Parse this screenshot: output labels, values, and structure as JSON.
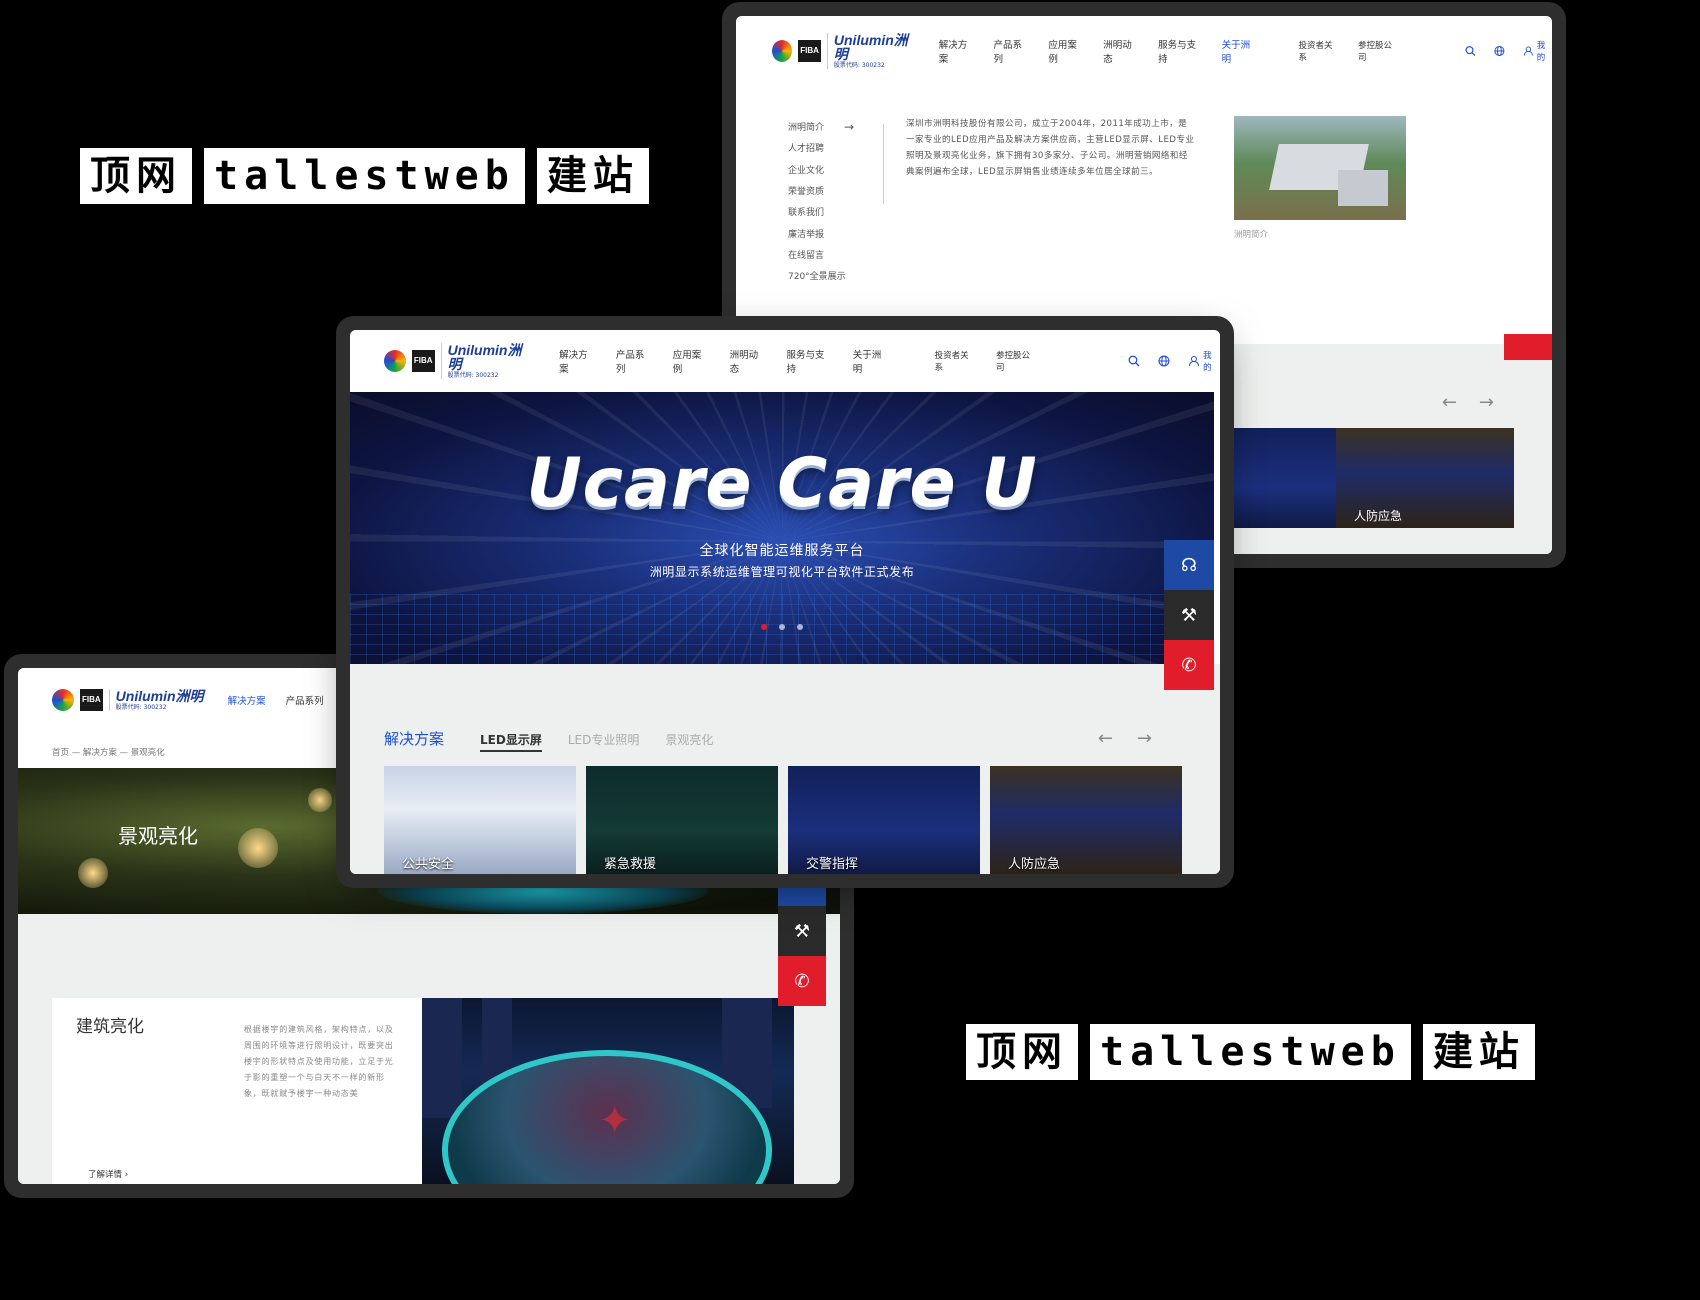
{
  "watermark": {
    "word1": "顶网",
    "word2": "tallestweb",
    "word3": "建站"
  },
  "brand": {
    "logo_text": "Unilumin洲明",
    "stock_code": "股票代码: 300232",
    "fiba": "FIBA"
  },
  "nav": {
    "items": [
      "解决方案",
      "产品系列",
      "应用案例",
      "洲明动态",
      "服务与支持",
      "关于洲明"
    ],
    "secondary": [
      "投资者关系",
      "参控股公司"
    ],
    "login": "我的"
  },
  "window_about": {
    "sidebar": [
      "洲明简介",
      "人才招聘",
      "企业文化",
      "荣誉资质",
      "联系我们",
      "廉洁举报",
      "在线留言",
      "720°全景展示"
    ],
    "intro": "深圳市洲明科技股份有限公司，成立于2004年，2011年成功上市，是一家专业的LED应用产品及解决方案供应商，主营LED显示屏、LED专业照明及景观亮化业务，旗下拥有30多家分、子公司。洲明营销网络和经典案例遍布全球，LED显示屏销售业绩连续多年位居全球前三。",
    "photo_caption": "洲明简介",
    "thumb_label": "人防应急"
  },
  "window_home": {
    "banner_title": "Ucare Care U",
    "banner_sub1": "全球化智能运维服务平台",
    "banner_sub2": "洲明显示系统运维管理可视化平台软件正式发布",
    "section_title": "解决方案",
    "tabs": [
      "LED显示屏",
      "LED专业照明",
      "景观亮化"
    ],
    "cards": [
      "公共安全",
      "紧急救援",
      "交警指挥",
      "人防应急"
    ]
  },
  "window_landscape": {
    "breadcrumb": "首页 — 解决方案 — 景观亮化",
    "hero_title": "景观亮化",
    "panel_title": "建筑亮化",
    "panel_text": "根据楼宇的建筑风格，架构特点，以及周围的环境等进行照明设计，既要突出楼宇的形状特点及使用功能，立足于光于影的重塑一个与白天不一样的新形象，既就赋予楼宇一种动态美",
    "more": "了解详情"
  },
  "icons": [
    "search-icon",
    "globe-icon",
    "user-icon",
    "headset-icon",
    "wrench-icon",
    "phone-icon",
    "arrow-left-icon",
    "arrow-right-icon"
  ],
  "colors": {
    "accent": "#1d4ed8",
    "red": "#e11d2b",
    "dark": "#2a2a2a",
    "panel_bg": "#eef0ef"
  }
}
